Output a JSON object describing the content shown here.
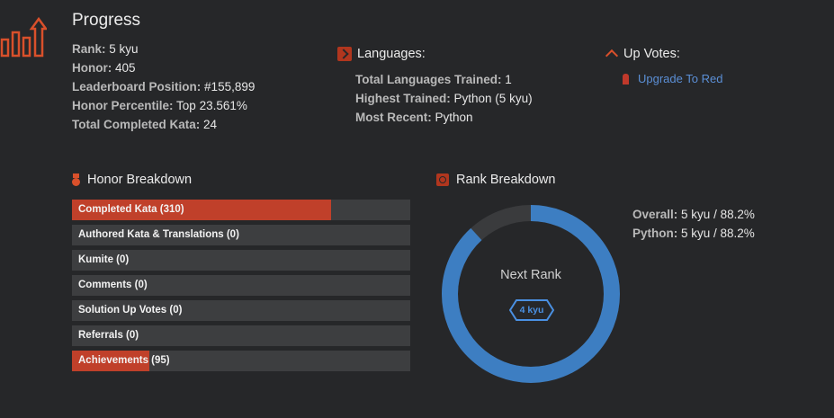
{
  "progress": {
    "title": "Progress",
    "icon": "bar-chart-arrow-icon",
    "stats": [
      {
        "key": "Rank:",
        "value": "5 kyu"
      },
      {
        "key": "Honor:",
        "value": "405"
      },
      {
        "key": "Leaderboard Position:",
        "value": "#155,899"
      },
      {
        "key": "Honor Percentile:",
        "value": "Top 23.561%"
      },
      {
        "key": "Total Completed Kata:",
        "value": "24"
      }
    ]
  },
  "languages": {
    "title": "Languages:",
    "icon": "terminal-icon",
    "stats": [
      {
        "key": "Total Languages Trained:",
        "value": "1"
      },
      {
        "key": "Highest Trained:",
        "value": "Python (5 kyu)"
      },
      {
        "key": "Most Recent:",
        "value": "Python"
      }
    ]
  },
  "upvotes": {
    "title": "Up Votes:",
    "icon": "chevron-up-icon",
    "link_label": "Upgrade To Red",
    "link_icon": "ribbon-icon"
  },
  "honor_breakdown": {
    "title": "Honor Breakdown",
    "icon": "medal-icon",
    "bars": [
      {
        "label": "Completed Kata (310)",
        "fill": 0.766
      },
      {
        "label": "Authored Kata & Translations (0)",
        "fill": 0
      },
      {
        "label": "Kumite (0)",
        "fill": 0
      },
      {
        "label": "Comments (0)",
        "fill": 0
      },
      {
        "label": "Solution Up Votes (0)",
        "fill": 0
      },
      {
        "label": "Referrals (0)",
        "fill": 0
      },
      {
        "label": "Achievements (95)",
        "fill": 0.229
      }
    ],
    "fill_color": "#c0402a",
    "track_color": "#3d3e40"
  },
  "rank_breakdown": {
    "title": "Rank Breakdown",
    "icon": "target-icon",
    "progress_fraction": 0.882,
    "progress_color": "#3d7ec2",
    "remaining_color": "#3a3b3d",
    "center_label": "Next Rank",
    "next_rank": "4 kyu",
    "stats": [
      {
        "key": "Overall:",
        "value": "5 kyu / 88.2%"
      },
      {
        "key": "Python:",
        "value": "5 kyu / 88.2%"
      }
    ]
  }
}
